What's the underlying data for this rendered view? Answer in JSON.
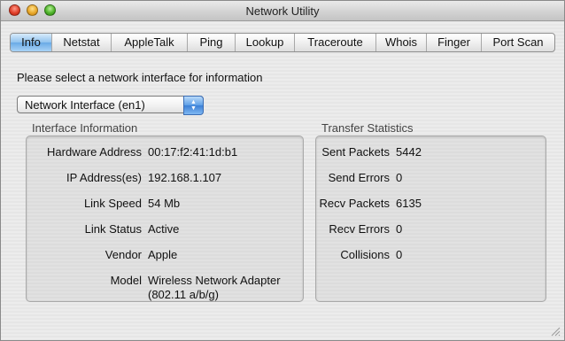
{
  "window": {
    "title": "Network Utility"
  },
  "tabs": [
    {
      "label": "Info",
      "active": true
    },
    {
      "label": "Netstat",
      "active": false
    },
    {
      "label": "AppleTalk",
      "active": false
    },
    {
      "label": "Ping",
      "active": false
    },
    {
      "label": "Lookup",
      "active": false
    },
    {
      "label": "Traceroute",
      "active": false
    },
    {
      "label": "Whois",
      "active": false
    },
    {
      "label": "Finger",
      "active": false
    },
    {
      "label": "Port Scan",
      "active": false
    }
  ],
  "info": {
    "prompt": "Please select a network interface for information",
    "interface_popup": {
      "selected": "Network Interface (en1)"
    },
    "interface_information": {
      "title": "Interface Information",
      "hardware_address": {
        "label": "Hardware Address",
        "value": "00:17:f2:41:1d:b1"
      },
      "ip_addresses": {
        "label": "IP Address(es)",
        "value": "192.168.1.107"
      },
      "link_speed": {
        "label": "Link Speed",
        "value": "54 Mb"
      },
      "link_status": {
        "label": "Link Status",
        "value": "Active"
      },
      "vendor": {
        "label": "Vendor",
        "value": "Apple"
      },
      "model": {
        "label": "Model",
        "value_line1": "Wireless Network Adapter",
        "value_line2": "(802.11 a/b/g)"
      }
    },
    "transfer_statistics": {
      "title": "Transfer Statistics",
      "sent_packets": {
        "label": "Sent Packets",
        "value": "5442"
      },
      "send_errors": {
        "label": "Send Errors",
        "value": "0"
      },
      "recv_packets": {
        "label": "Recv Packets",
        "value": "6135"
      },
      "recv_errors": {
        "label": "Recv Errors",
        "value": "0"
      },
      "collisions": {
        "label": "Collisions",
        "value": "0"
      }
    }
  },
  "colors": {
    "active_tab": "#8fc2ee",
    "close": "#e0402a",
    "minimize": "#e8a82a",
    "zoom": "#4fb42a"
  }
}
